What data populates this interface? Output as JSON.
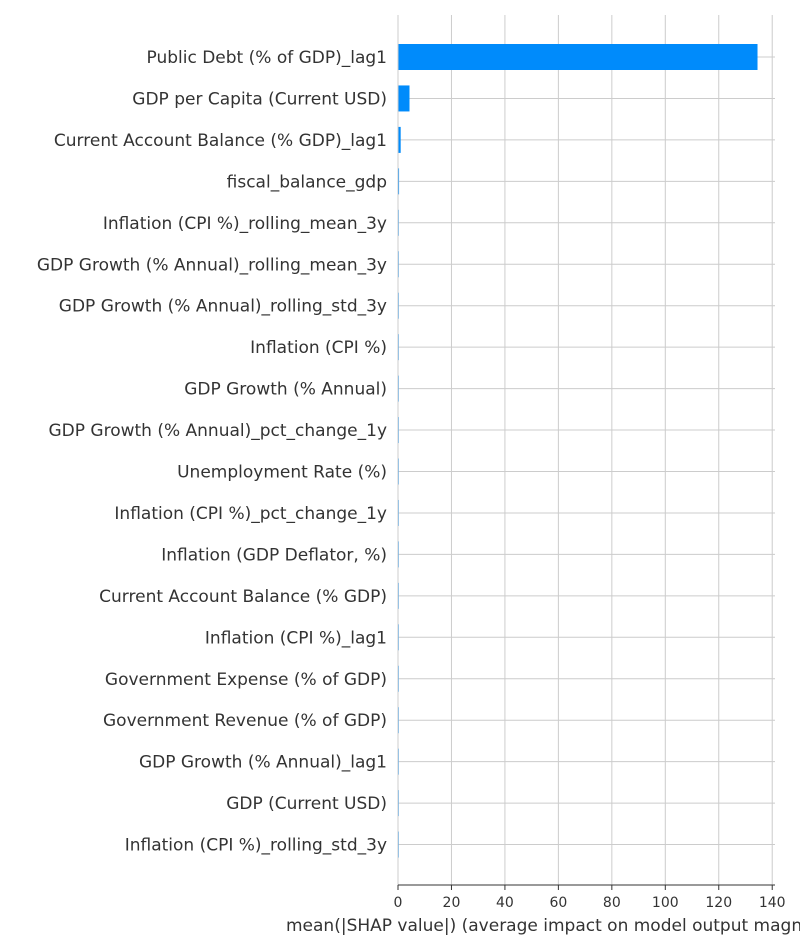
{
  "chart_data": {
    "type": "bar",
    "orientation": "horizontal",
    "title": "",
    "xlabel": "mean(|SHAP value|) (average impact on model output magnitude)",
    "ylabel": "",
    "xlim": [
      0,
      140
    ],
    "xticks": [
      0,
      20,
      40,
      60,
      80,
      100,
      120,
      140
    ],
    "grid": true,
    "bar_color": "#008bfb",
    "categories": [
      "Public Debt (% of GDP)_lag1",
      "GDP per Capita (Current USD)",
      "Current Account Balance (% GDP)_lag1",
      "fiscal_balance_gdp",
      "Inflation (CPI %)_rolling_mean_3y",
      "GDP Growth (% Annual)_rolling_mean_3y",
      "GDP Growth (% Annual)_rolling_std_3y",
      "Inflation (CPI %)",
      "GDP Growth (% Annual)",
      "GDP Growth (% Annual)_pct_change_1y",
      "Unemployment Rate (%)",
      "Inflation (CPI %)_pct_change_1y",
      "Inflation (GDP Deflator, %)",
      "Current Account Balance (% GDP)",
      "Inflation (CPI %)_lag1",
      "Government Expense (% of GDP)",
      "Government Revenue (% of GDP)",
      "GDP Growth (% Annual)_lag1",
      "GDP (Current USD)",
      "Inflation (CPI %)_rolling_std_3y"
    ],
    "values": [
      134.5,
      4.3,
      1.0,
      0.4,
      0.3,
      0.3,
      0.15,
      0.1,
      0.1,
      0.08,
      0.07,
      0.06,
      0.05,
      0.05,
      0.04,
      0.04,
      0.03,
      0.03,
      0.02,
      0.02
    ]
  }
}
